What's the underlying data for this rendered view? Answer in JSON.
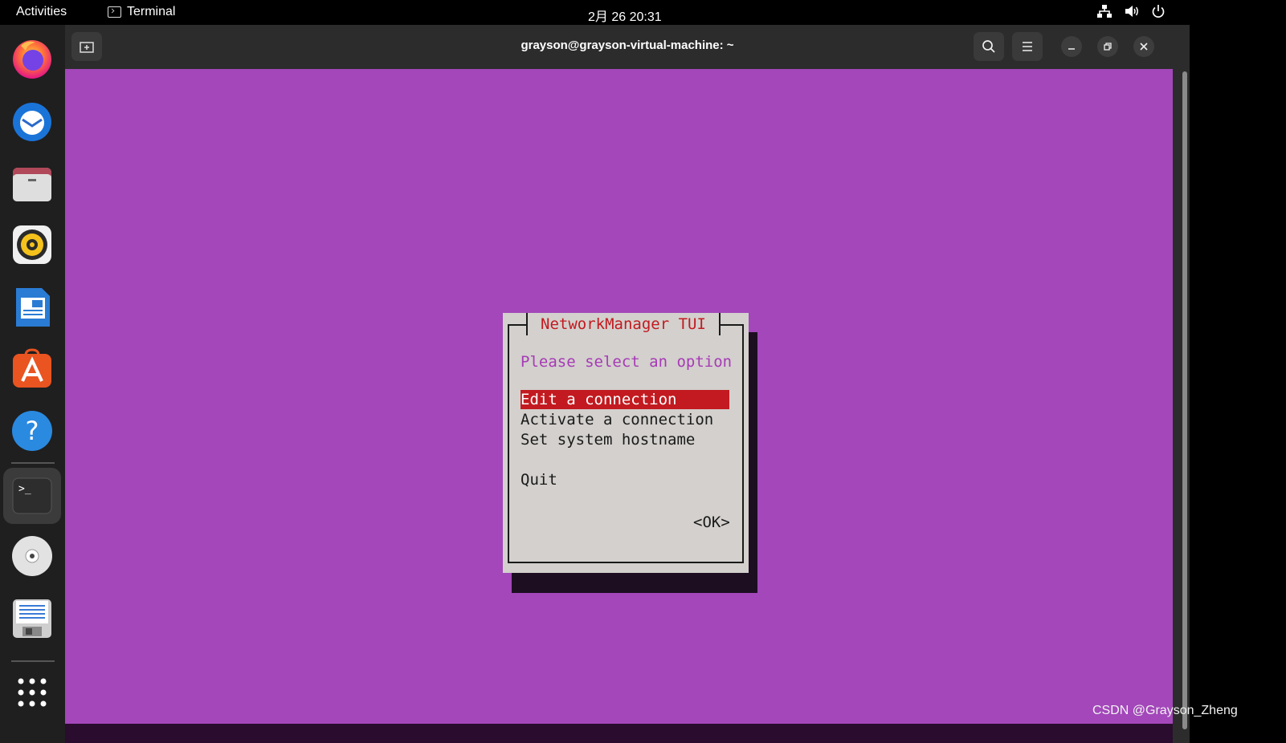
{
  "topbar": {
    "activities_label": "Activities",
    "app_name": "Terminal",
    "clock": "2月 26  20:31"
  },
  "dock": {
    "items": [
      "firefox-icon",
      "thunderbird-icon",
      "files-icon",
      "rhythmbox-icon",
      "libreoffice-writer-icon",
      "app-center-icon",
      "help-icon",
      "terminal-icon",
      "disc-icon",
      "save-disk-icon",
      "show-apps-grid-icon"
    ],
    "accent_color": "#e95420"
  },
  "window": {
    "title": "grayson@grayson-virtual-machine: ~",
    "terminal_bg": "#a347ba"
  },
  "dialog": {
    "title": "NetworkManager TUI",
    "prompt": "Please select an option",
    "options": [
      "Edit a connection",
      "Activate a connection",
      "Set system hostname"
    ],
    "quit_label": "Quit",
    "ok_label": "<OK>",
    "selected_index": 0,
    "selection_color": "#c21a20"
  },
  "watermark": "CSDN @Grayson_Zheng"
}
